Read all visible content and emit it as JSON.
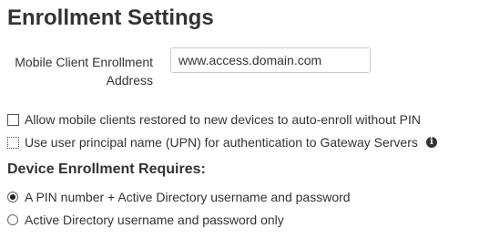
{
  "title": "Enrollment Settings",
  "enrollment_address": {
    "label": "Mobile Client Enrollment Address",
    "value": "www.access.domain.com"
  },
  "checkboxes": [
    {
      "label": "Allow mobile clients restored to new devices to auto-enroll without PIN",
      "checked": false
    },
    {
      "label": "Use user principal name (UPN) for authentication to Gateway Servers",
      "checked": false,
      "icon": "info-icon"
    }
  ],
  "requirements": {
    "title": "Device Enrollment Requires:",
    "options": [
      {
        "label": "A PIN number + Active Directory username and password",
        "selected": true
      },
      {
        "label": "Active Directory username and password only",
        "selected": false
      }
    ]
  }
}
